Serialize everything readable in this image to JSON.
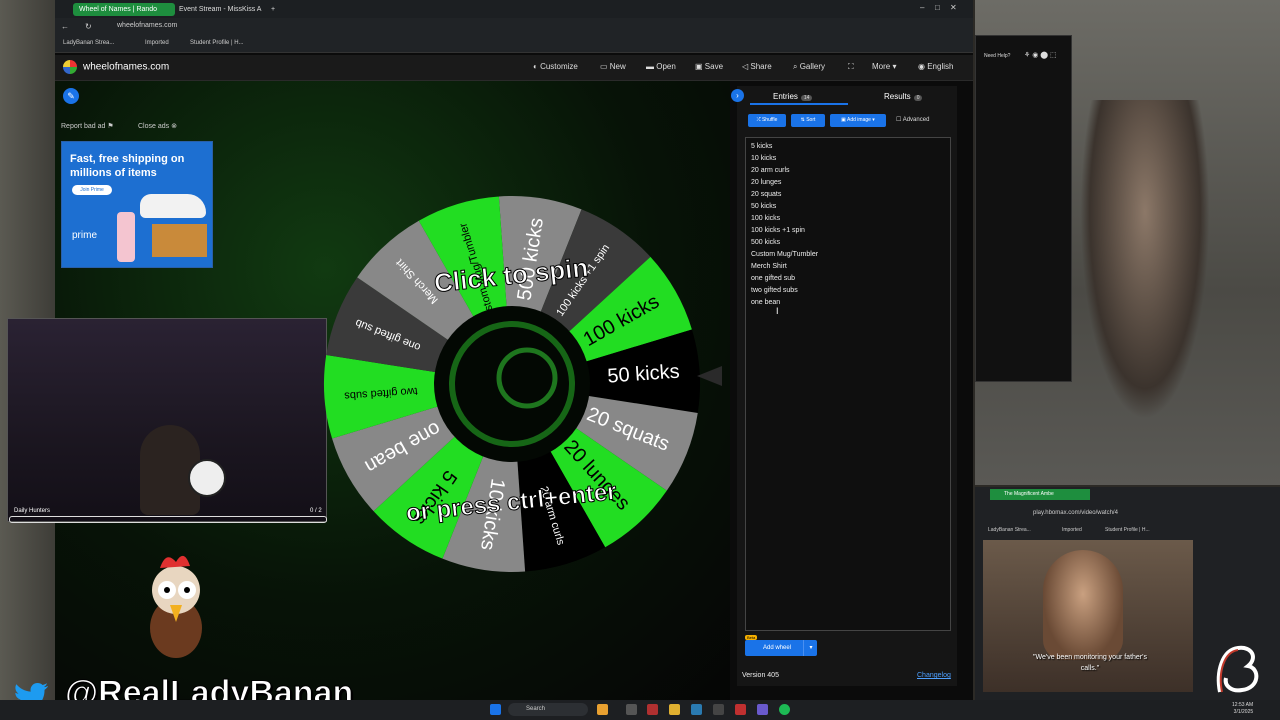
{
  "browser": {
    "tabs": [
      {
        "label": "Wheel of Names | Rando"
      },
      {
        "label": "Event Stream - MissKiss A"
      }
    ],
    "address": "wheelofnames.com",
    "bookmarks": [
      "LadyBanan Strea...",
      "Imported",
      "Student Profile | H..."
    ]
  },
  "nav": {
    "brand": "wheelofnames.com",
    "items": [
      "Customize",
      "New",
      "Open",
      "Save",
      "Share",
      "Gallery",
      "More",
      "English"
    ]
  },
  "ad": {
    "report": "Report bad ad",
    "close": "Close ads",
    "headline": "Fast, free shipping on millions of items",
    "button": "Join Prime",
    "brand": "prime"
  },
  "wheel": {
    "click_text": "Click to spin",
    "press_text": "or press ctrl+enter",
    "segments": [
      {
        "label": "500 kicks",
        "color": "#888888"
      },
      {
        "label": "100 kicks +1 spin",
        "color": "#3a3a3a"
      },
      {
        "label": "100 kicks",
        "color": "#22dd22"
      },
      {
        "label": "50 kicks",
        "color": "#000000"
      },
      {
        "label": "20 squats",
        "color": "#888888"
      },
      {
        "label": "20 lunges",
        "color": "#22dd22"
      },
      {
        "label": "20 arm curls",
        "color": "#000000"
      },
      {
        "label": "10 kicks",
        "color": "#888888"
      },
      {
        "label": "5 kicks",
        "color": "#22dd22"
      },
      {
        "label": "one bean",
        "color": "#888888"
      },
      {
        "label": "two gifted subs",
        "color": "#22dd22"
      },
      {
        "label": "one gifted sub",
        "color": "#3a3a3a"
      },
      {
        "label": "Merch Shirt",
        "color": "#888888"
      },
      {
        "label": "Custom Mug/Tumbler",
        "color": "#22dd22"
      }
    ]
  },
  "panel": {
    "tab_entries": "Entries",
    "entries_count": "14",
    "tab_results": "Results",
    "results_count": "0",
    "shuffle": "Shuffle",
    "sort": "Sort",
    "add_image": "Add image",
    "advanced": "Advanced",
    "entries": [
      "5 kicks",
      "10 kicks",
      "20 arm curls",
      "20 lunges",
      "20 squats",
      "50 kicks",
      "100 kicks",
      "100 kicks +1 spin",
      "500 kicks",
      "Custom Mug/Tumbler",
      "Merch Shirt",
      "one gifted sub",
      "two gifted subs",
      "one bean"
    ],
    "beta": "Beta",
    "add_wheel": "Add wheel",
    "version": "Version 405",
    "changelog": "Changelog"
  },
  "stream": {
    "cam_name": "Daily Hunters",
    "cam_count": "0 / 2",
    "handle": "@RealLadyBanan"
  },
  "side": {
    "help": "Need Help?",
    "mini_tab": "The Magnificent Ambe",
    "mini_address": "play.hbomax.com/video/watch/4",
    "mini_bookmarks": [
      "LadyBanan Strea...",
      "Imported",
      "Student Profile | H..."
    ],
    "subtitle": "\"We've been monitoring your father's calls.\""
  },
  "taskbar": {
    "search": "Search",
    "time": "12:53 AM",
    "date": "3/1/2025"
  }
}
